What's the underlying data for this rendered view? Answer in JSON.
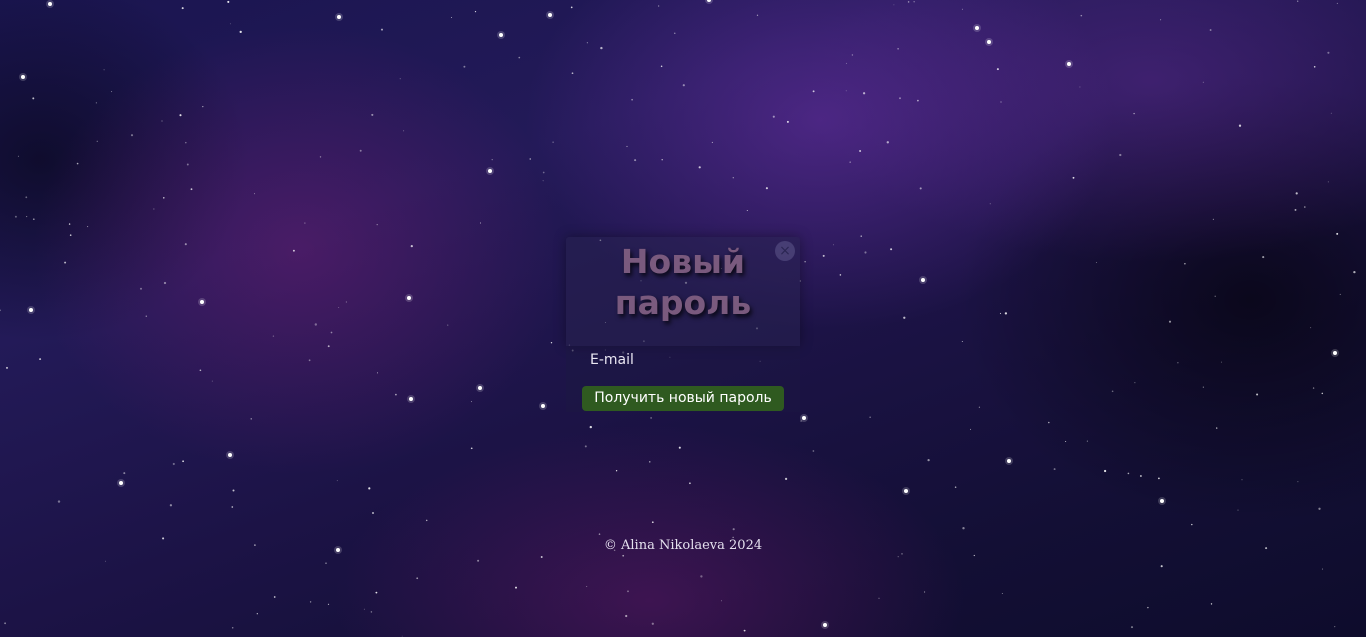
{
  "dialog": {
    "title_line1": "Новый",
    "title_line2": "пароль",
    "close_symbol": "×",
    "email_label": "E-mail",
    "submit_label": "Получить новый пароль"
  },
  "footer": {
    "copyright": "© Alina Nikolaeva 2024"
  },
  "colors": {
    "title": "#7a5a7e",
    "button_bg": "#2f5a20",
    "button_text": "#ffffff",
    "background_deep": "#130f35",
    "background_purple": "#6e32aa"
  },
  "icons": {
    "close": "close-icon"
  }
}
